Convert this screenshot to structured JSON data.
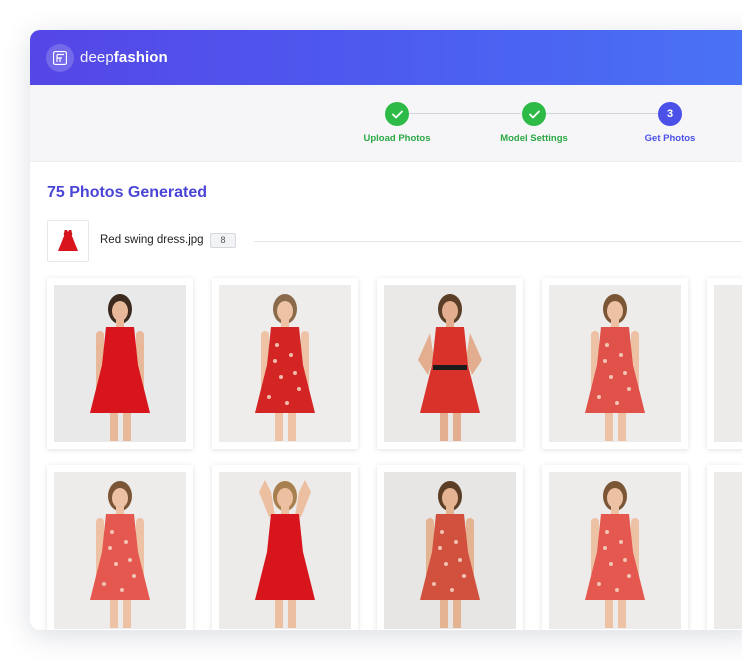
{
  "app": {
    "brand_light": "deep",
    "brand_bold": "fashion",
    "logo_icon": "fashion-logo-icon"
  },
  "steps": [
    {
      "label": "Upload Photos",
      "status": "done",
      "marker": "✓"
    },
    {
      "label": "Model Settings",
      "status": "done",
      "marker": "✓"
    },
    {
      "label": "Get Photos",
      "status": "active",
      "marker": "3"
    }
  ],
  "results": {
    "title": "75 Photos Generated",
    "file": {
      "name": "Red swing dress.jpg",
      "count": "8"
    }
  },
  "colors": {
    "header_start": "#5546e6",
    "header_end": "#4a73f5",
    "accent": "#4a45d6",
    "success": "#2dba47"
  },
  "photos": [
    {
      "description": "model in red spaghetti-strap mini dress",
      "dress_color": "#d8141c"
    },
    {
      "description": "model in red floral wrap dress",
      "dress_color": "#d42525"
    },
    {
      "description": "model in red wrap dress with black belt",
      "dress_color": "#d9322a"
    },
    {
      "description": "model in coral floral wrap dress",
      "dress_color": "#e0514a"
    },
    {
      "description": "partially visible model in red dress",
      "dress_color": "#cc1f25"
    },
    {
      "description": "model in coral floral wrap dress",
      "dress_color": "#e4584f"
    },
    {
      "description": "model in red strappy dress, arms raised",
      "dress_color": "#d8141c"
    },
    {
      "description": "model in floral dress, back view",
      "dress_color": "#d2503e"
    },
    {
      "description": "model in coral floral wrap dress",
      "dress_color": "#e4584f"
    },
    {
      "description": "partially visible model in coral dress",
      "dress_color": "#e0564d"
    }
  ]
}
